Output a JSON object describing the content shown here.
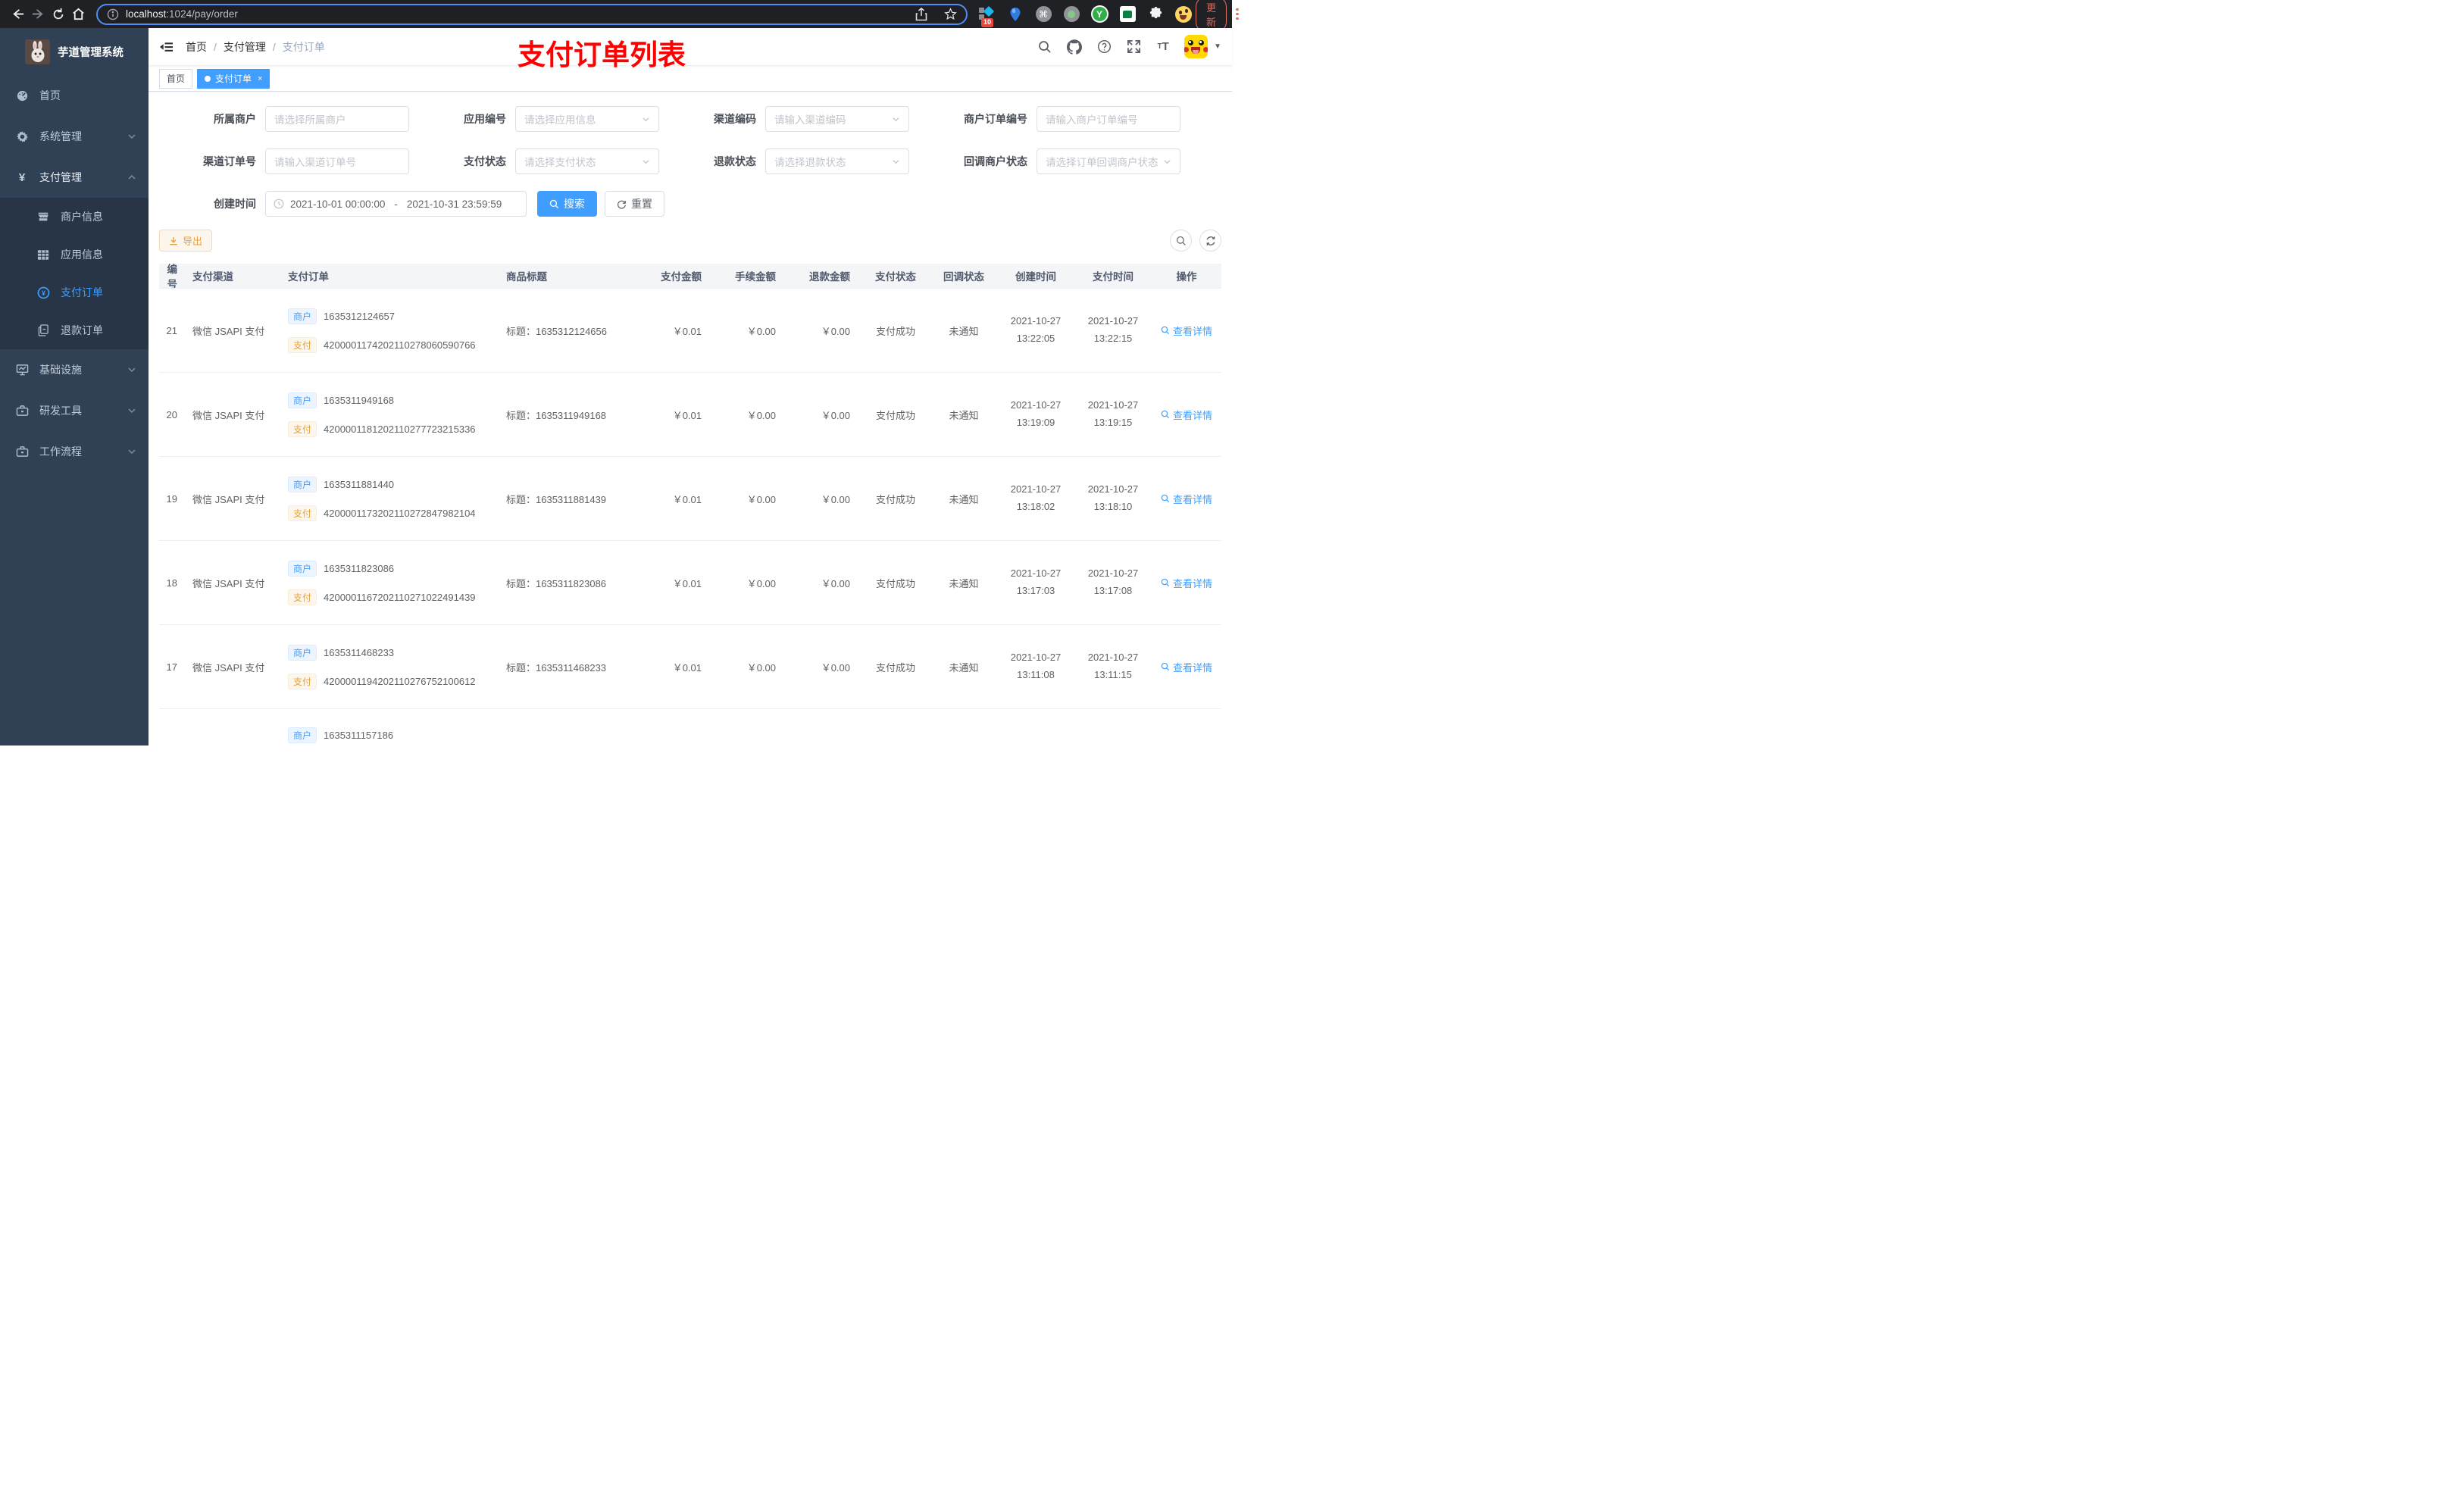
{
  "browser": {
    "url_host": "localhost",
    "url_rest": ":1024/pay/order",
    "update_label": "更新",
    "ext_badge": "10",
    "ext_y_label": "Y"
  },
  "sidebar": {
    "title": "芋道管理系统",
    "items": {
      "home": "首页",
      "system": "系统管理",
      "pay": "支付管理",
      "merchant_info": "商户信息",
      "app_info": "应用信息",
      "pay_order": "支付订单",
      "refund_order": "退款订单",
      "infra": "基础设施",
      "devtools": "研发工具",
      "workflow": "工作流程"
    }
  },
  "navbar": {
    "breadcrumb": [
      "首页",
      "支付管理",
      "支付订单"
    ],
    "annotation": "支付订单列表",
    "annotation_color": "#ff0000"
  },
  "tabs": {
    "home": "首页",
    "active": "支付订单",
    "close": "×"
  },
  "filters": {
    "merchant": {
      "label": "所属商户",
      "placeholder": "请选择所属商户"
    },
    "app": {
      "label": "应用编号",
      "placeholder": "请选择应用信息"
    },
    "channel_code": {
      "label": "渠道编码",
      "placeholder": "请输入渠道编码"
    },
    "merchant_order_no": {
      "label": "商户订单编号",
      "placeholder": "请输入商户订单编号"
    },
    "channel_order_no": {
      "label": "渠道订单号",
      "placeholder": "请输入渠道订单号"
    },
    "pay_status": {
      "label": "支付状态",
      "placeholder": "请选择支付状态"
    },
    "refund_status": {
      "label": "退款状态",
      "placeholder": "请选择退款状态"
    },
    "notify_status": {
      "label": "回调商户状态",
      "placeholder": "请选择订单回调商户状态"
    },
    "create_time": {
      "label": "创建时间",
      "start": "2021-10-01 00:00:00",
      "separator": "-",
      "end": "2021-10-31 23:59:59"
    },
    "search_label": "搜索",
    "reset_label": "重置"
  },
  "toolbar": {
    "export_label": "导出"
  },
  "table": {
    "columns": [
      "编号",
      "支付渠道",
      "支付订单",
      "商品标题",
      "支付金额",
      "手续金额",
      "退款金额",
      "支付状态",
      "回调状态",
      "创建时间",
      "支付时间",
      "操作"
    ],
    "tag_merchant": "商户",
    "tag_pay": "支付",
    "action_label": "查看详情",
    "rows": [
      {
        "id": "21",
        "channel": "微信 JSAPI 支付",
        "merchant_no": "1635312124657",
        "pay_no": "4200001174202110278060590766",
        "title": "标题：1635312124656",
        "amount": "￥0.01",
        "fee": "￥0.00",
        "refund": "￥0.00",
        "status": "支付成功",
        "notify": "未通知",
        "created_date": "2021-10-27",
        "created_time": "13:22:05",
        "paid_date": "2021-10-27",
        "paid_time": "13:22:15"
      },
      {
        "id": "20",
        "channel": "微信 JSAPI 支付",
        "merchant_no": "1635311949168",
        "pay_no": "4200001181202110277723215336",
        "title": "标题：1635311949168",
        "amount": "￥0.01",
        "fee": "￥0.00",
        "refund": "￥0.00",
        "status": "支付成功",
        "notify": "未通知",
        "created_date": "2021-10-27",
        "created_time": "13:19:09",
        "paid_date": "2021-10-27",
        "paid_time": "13:19:15"
      },
      {
        "id": "19",
        "channel": "微信 JSAPI 支付",
        "merchant_no": "1635311881440",
        "pay_no": "4200001173202110272847982104",
        "title": "标题：1635311881439",
        "amount": "￥0.01",
        "fee": "￥0.00",
        "refund": "￥0.00",
        "status": "支付成功",
        "notify": "未通知",
        "created_date": "2021-10-27",
        "created_time": "13:18:02",
        "paid_date": "2021-10-27",
        "paid_time": "13:18:10"
      },
      {
        "id": "18",
        "channel": "微信 JSAPI 支付",
        "merchant_no": "1635311823086",
        "pay_no": "4200001167202110271022491439",
        "title": "标题：1635311823086",
        "amount": "￥0.01",
        "fee": "￥0.00",
        "refund": "￥0.00",
        "status": "支付成功",
        "notify": "未通知",
        "created_date": "2021-10-27",
        "created_time": "13:17:03",
        "paid_date": "2021-10-27",
        "paid_time": "13:17:08"
      },
      {
        "id": "17",
        "channel": "微信 JSAPI 支付",
        "merchant_no": "1635311468233",
        "pay_no": "4200001194202110276752100612",
        "title": "标题：1635311468233",
        "amount": "￥0.01",
        "fee": "￥0.00",
        "refund": "￥0.00",
        "status": "支付成功",
        "notify": "未通知",
        "created_date": "2021-10-27",
        "created_time": "13:11:08",
        "paid_date": "2021-10-27",
        "paid_time": "13:11:15"
      }
    ],
    "partial_row": {
      "merchant_no": "1635311157186"
    }
  },
  "colors": {
    "accent": "#409eff",
    "warning": "#e6a23c",
    "sidebar_bg": "#304156",
    "submenu_bg": "#273546",
    "annotation_red": "#ff0000"
  }
}
